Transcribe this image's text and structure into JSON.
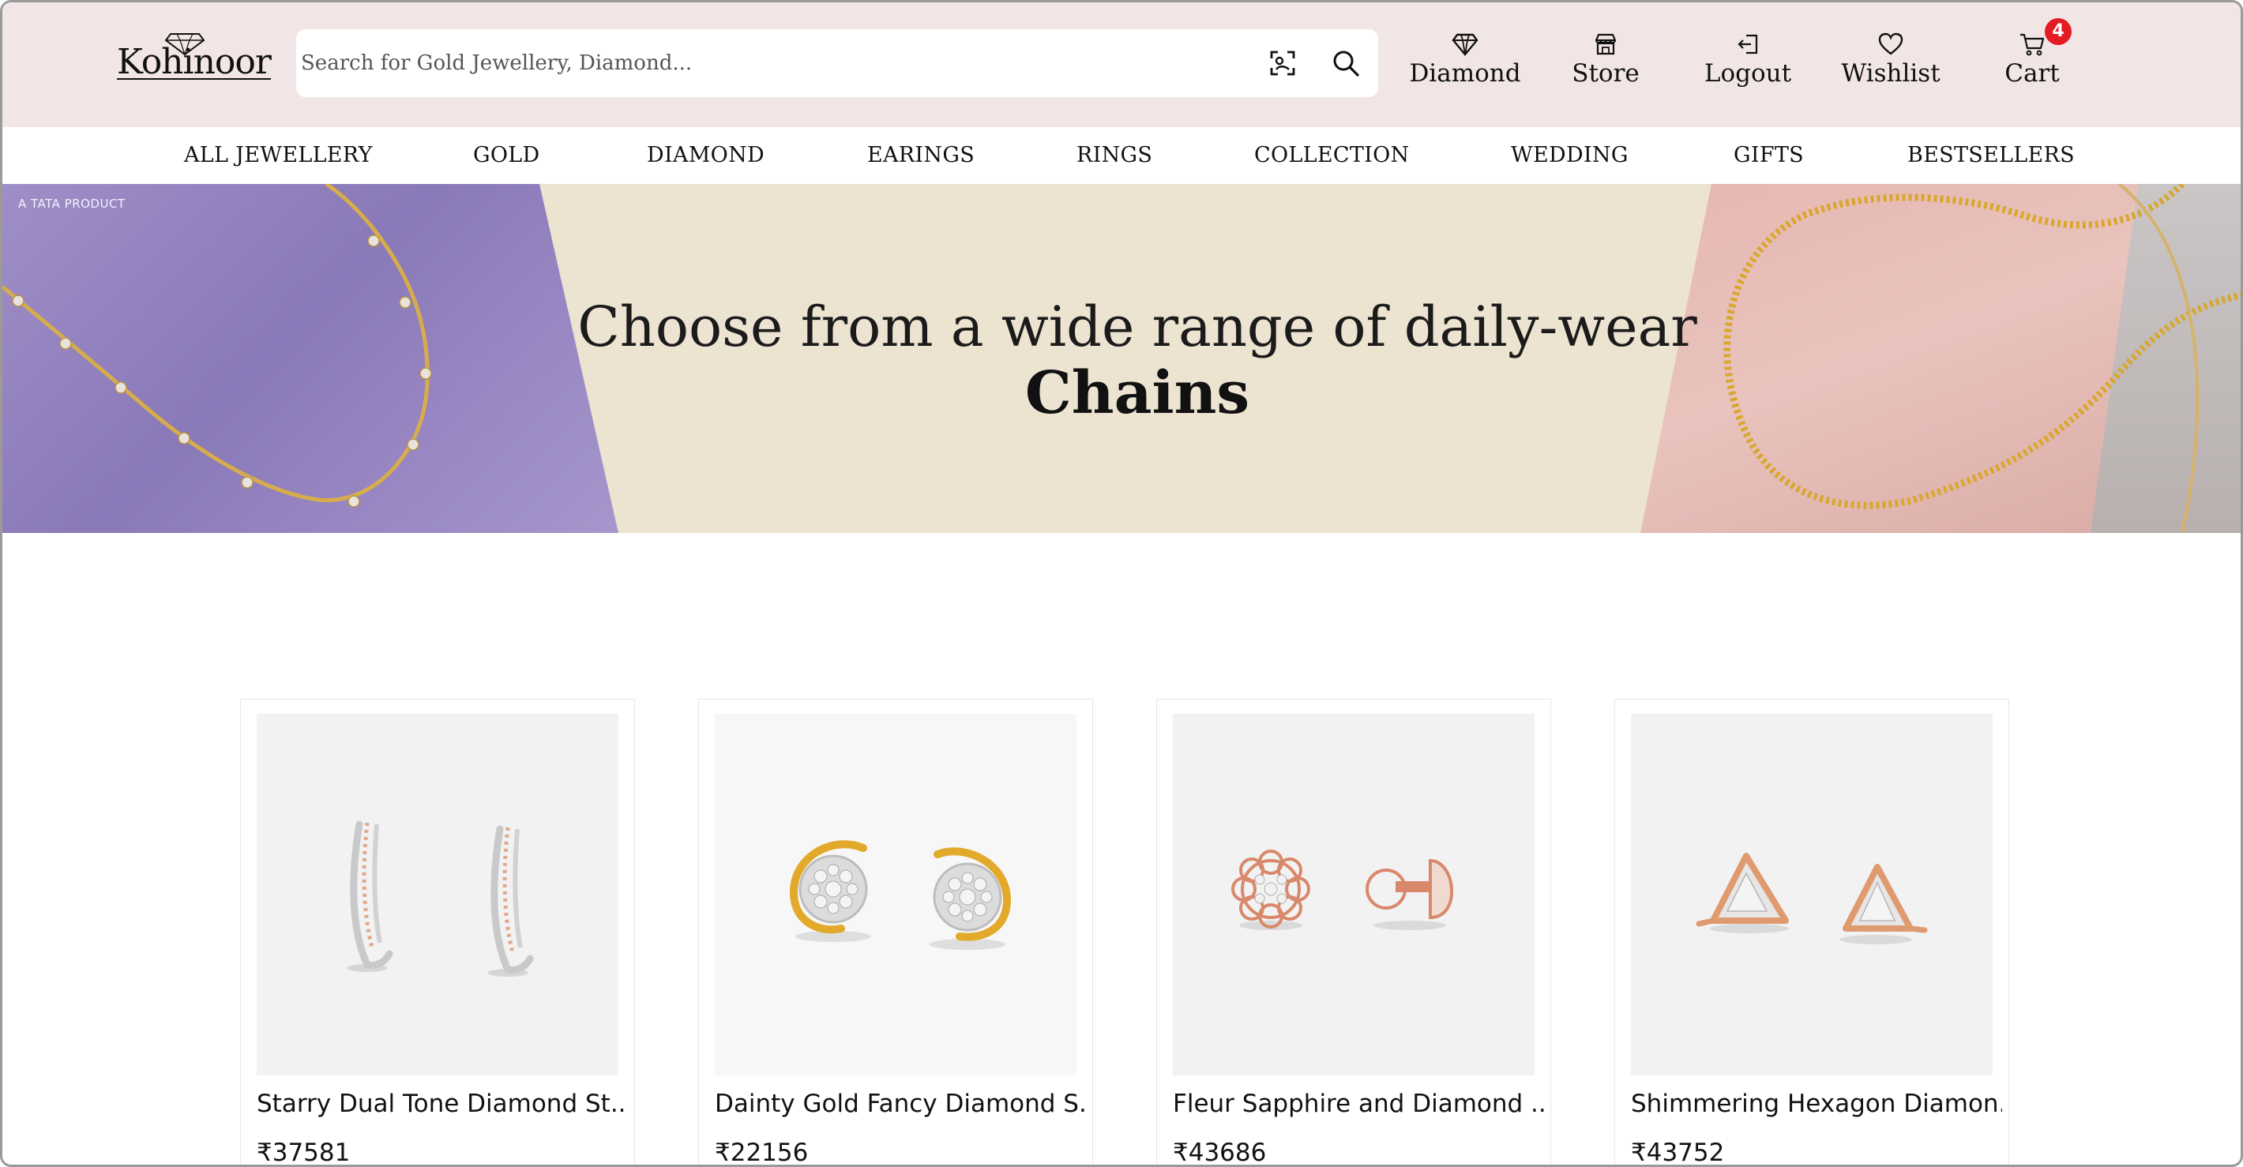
{
  "header": {
    "logo_text": "Kohinoor",
    "search_placeholder": "Search for Gold Jewellery, Diamond...",
    "actions": [
      {
        "label": "Diamond",
        "icon": "diamond-icon"
      },
      {
        "label": "Store",
        "icon": "store-icon"
      },
      {
        "label": "Logout",
        "icon": "logout-icon"
      },
      {
        "label": "Wishlist",
        "icon": "heart-icon"
      },
      {
        "label": "Cart",
        "icon": "cart-icon"
      }
    ],
    "cart_count": "4"
  },
  "categories": [
    "ALL JEWELLERY",
    "GOLD",
    "DIAMOND",
    "EARINGS",
    "RINGS",
    "COLLECTION",
    "WEDDING",
    "GIFTS",
    "BESTSELLERS"
  ],
  "banner": {
    "brand_tag": "A TATA PRODUCT",
    "line1": "Choose from a wide range of daily-wear",
    "line2": "Chains"
  },
  "products": [
    {
      "name": "Starry Dual Tone Diamond St...",
      "price": "₹37581",
      "image": "dual-tone-hoop-earrings"
    },
    {
      "name": "Dainty Gold Fancy Diamond S...",
      "price": "₹22156",
      "image": "gold-crescent-diamond-studs"
    },
    {
      "name": "Fleur Sapphire and Diamond ...",
      "price": "₹43686",
      "image": "rose-gold-flower-studs"
    },
    {
      "name": "Shimmering Hexagon Diamon...",
      "price": "₹43752",
      "image": "rose-gold-triangle-studs"
    }
  ],
  "colors": {
    "header_bg": "#f1e6e5",
    "badge": "#e31b23",
    "banner_cream": "#ece3d1",
    "banner_lavender": "#9f8ec6",
    "banner_pink": "#e7b7b1"
  }
}
